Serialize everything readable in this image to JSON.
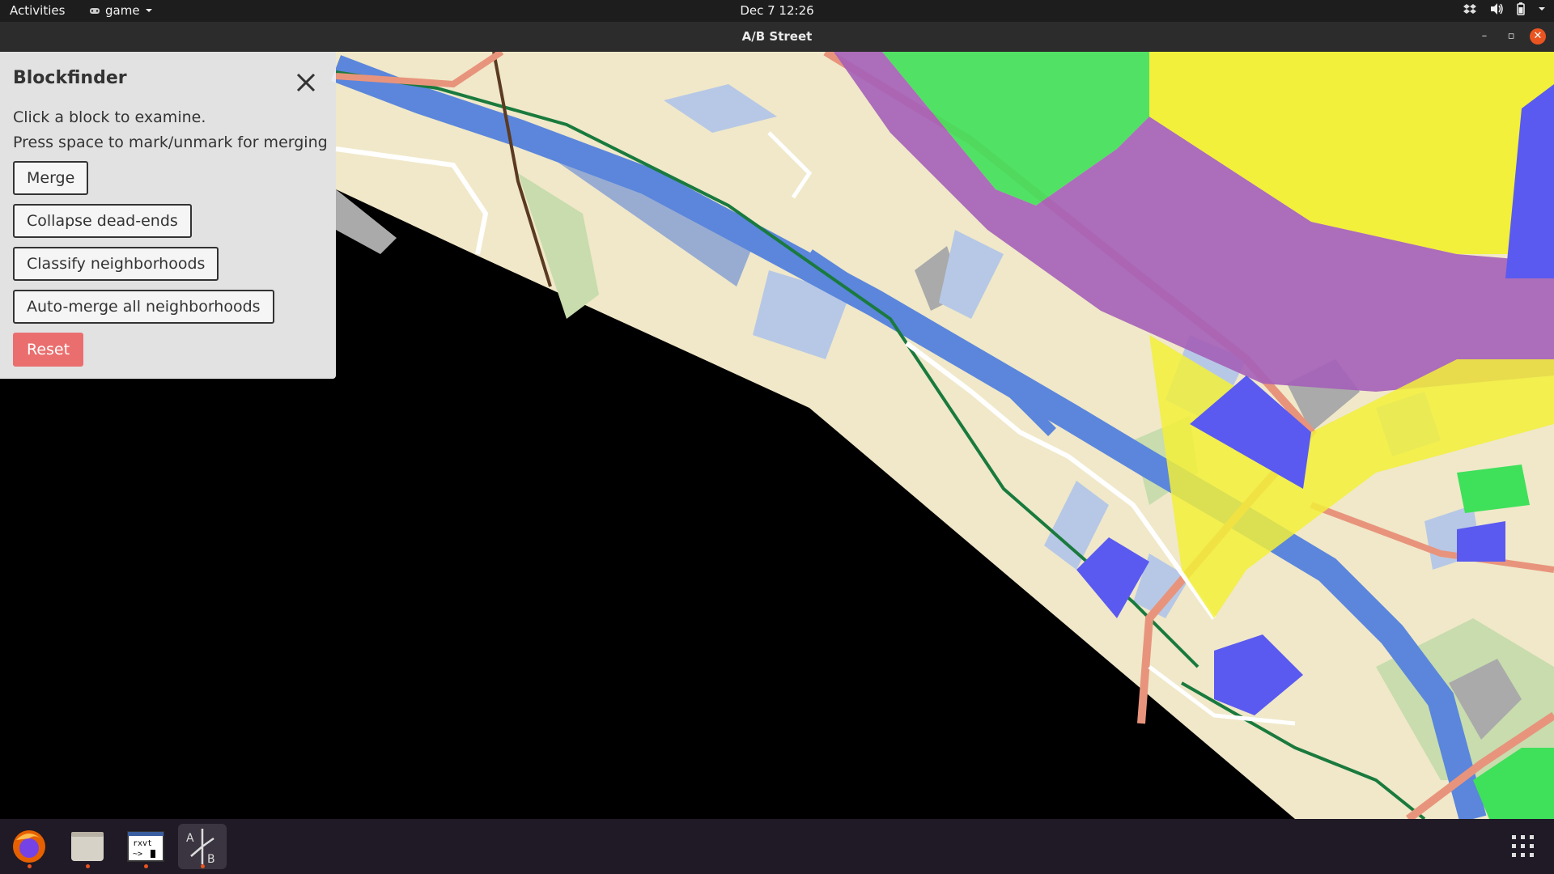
{
  "topbar": {
    "activities": "Activities",
    "app_menu": "game",
    "clock": "Dec 7  12:26"
  },
  "window": {
    "title": "A/B Street"
  },
  "panel": {
    "title": "Blockfinder",
    "instruction_1": "Click a block to examine.",
    "instruction_2": "Press space to mark/unmark for merging",
    "buttons": {
      "merge": "Merge",
      "collapse": "Collapse dead-ends",
      "classify": "Classify neighborhoods",
      "automerge": "Auto-merge all neighborhoods",
      "reset": "Reset"
    }
  },
  "dock": {
    "terminal_text_1": "rxvt",
    "terminal_text_2": "~>",
    "abstreet_icon_a": "A",
    "abstreet_icon_b": "B"
  },
  "colors": {
    "land": "#f0e8c9",
    "river": "#5b86dc",
    "building": "#b7c8e6",
    "road_major": "#e8947c",
    "rail": "#1a7a3e",
    "block_green": "#3fe05a",
    "block_purple": "#a45fb8",
    "block_yellow": "#f2f03a",
    "block_blue": "#5a5af0",
    "reset_button": "#eb6e6e",
    "accent_close": "#e95420"
  }
}
